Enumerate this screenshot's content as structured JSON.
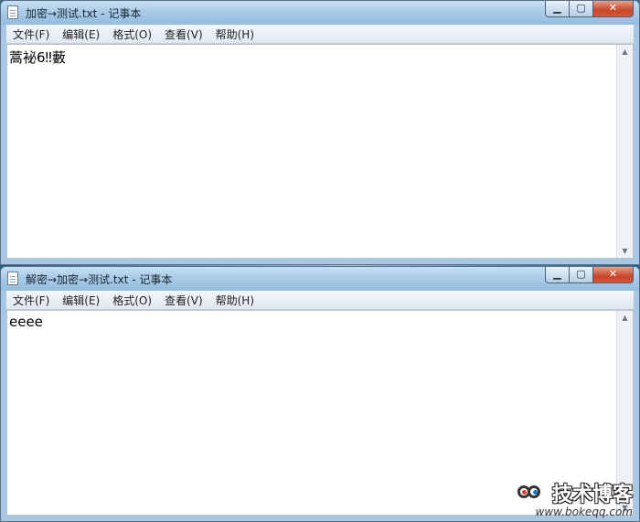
{
  "windows": [
    {
      "title": "加密→测试.txt - 记事本",
      "menus": [
        "文件(F)",
        "编辑(E)",
        "格式(O)",
        "查看(V)",
        "帮助(H)"
      ],
      "content": "蒿袐6‼藪"
    },
    {
      "title": "解密→加密→测试.txt - 记事本",
      "menus": [
        "文件(F)",
        "编辑(E)",
        "格式(O)",
        "查看(V)",
        "帮助(H)"
      ],
      "content": "eeee"
    }
  ],
  "icons": {
    "document": "notepad-document-icon",
    "minimize": "minimize-icon",
    "maximize": "maximize-icon",
    "close": "close-icon",
    "scroll_up": "scroll-up-icon",
    "scroll_down": "scroll-down-icon"
  },
  "colors": {
    "title_bar": "#a9cbe7",
    "close_button": "#c7452a",
    "editor_bg": "#ffffff"
  },
  "watermark": {
    "name": "技术博客",
    "url": "www.bokeqq.com"
  }
}
